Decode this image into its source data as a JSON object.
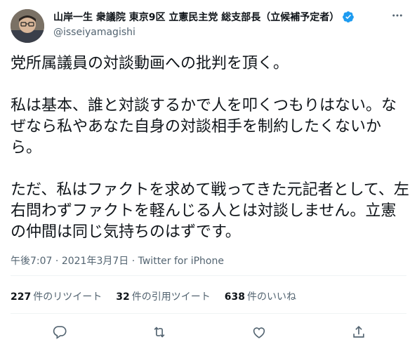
{
  "author": {
    "display_name": "山岸一生 衆議院 東京9区 立憲民主党 総支部長（立候補予定者）",
    "handle": "@isseiyamagishi",
    "verified": true
  },
  "tweet": {
    "paragraphs": [
      "党所属議員の対談動画への批判を頂く。",
      "私は基本、誰と対談するかで人を叩くつもりはない。なぜなら私やあなた自身の対談相手を制約したくないから。",
      "ただ、私はファクトを求めて戦ってきた元記者として、左右問わずファクトを軽んじる人とは対談しません。立憲の仲間は同じ気持ちのはずです。"
    ],
    "time": "午後7:07",
    "separator": "·",
    "date": "2021年3月7日",
    "source": "Twitter for iPhone"
  },
  "stats": {
    "retweets": {
      "count": "227",
      "label": "件のリツイート"
    },
    "quotes": {
      "count": "32",
      "label": "件の引用ツイート"
    },
    "likes": {
      "count": "638",
      "label": "件のいいね"
    }
  },
  "icons": [
    "more-icon",
    "verified-icon",
    "reply-icon",
    "retweet-icon",
    "like-icon",
    "share-icon"
  ],
  "colors": {
    "text": "#0f1419",
    "secondary": "#536471",
    "verified": "#1d9bf0",
    "divider": "#eff3f4"
  }
}
